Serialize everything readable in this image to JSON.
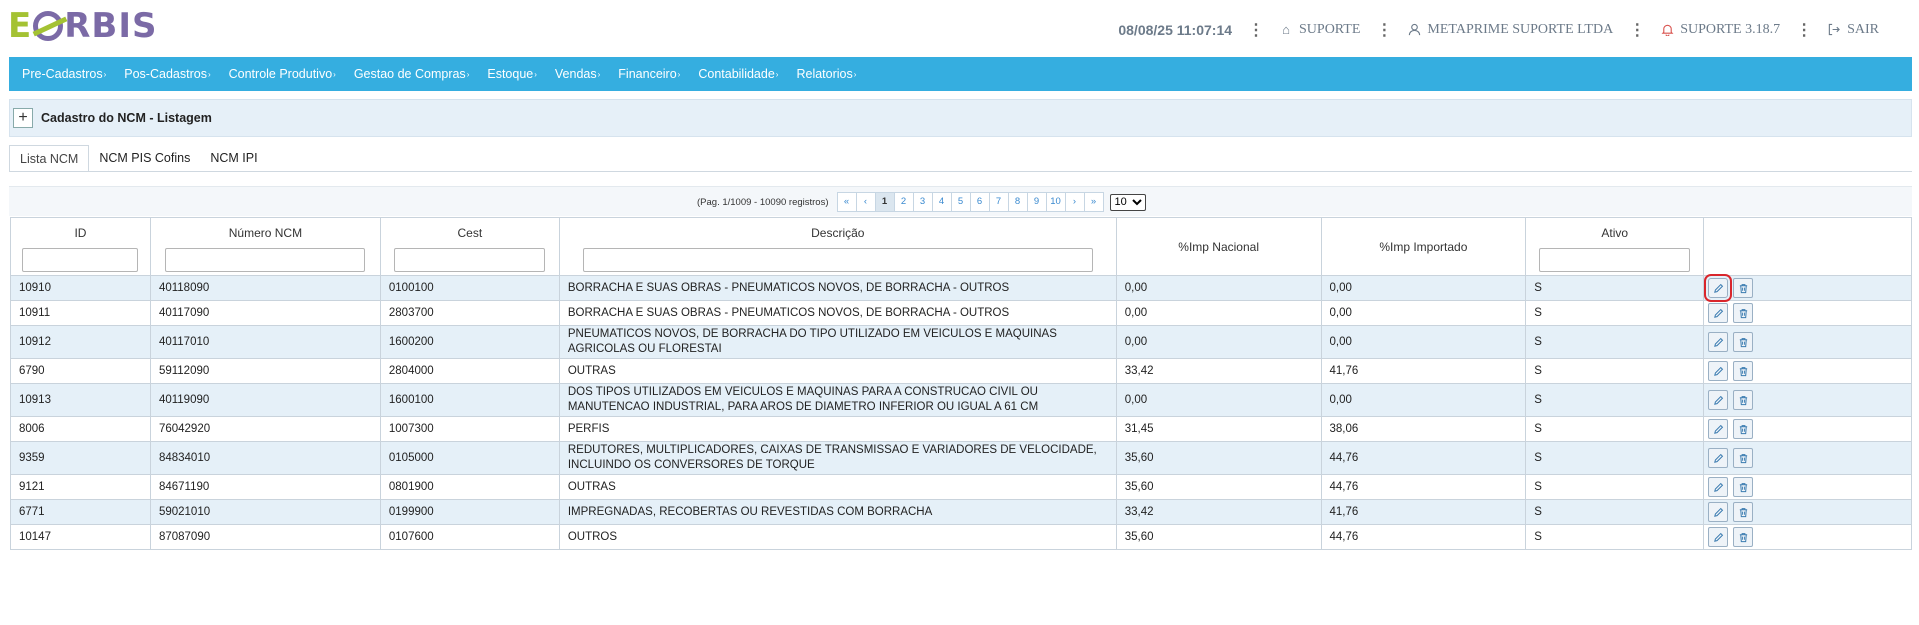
{
  "header": {
    "logo_e": "E",
    "logo_rest": "RBIS",
    "datetime": "08/08/25 11:07:14",
    "support_label": "SUPORTE",
    "company_label": "METAPRIME SUPORTE LTDA",
    "version_label": "SUPORTE 3.18.7",
    "exit_label": "SAIR"
  },
  "menu": [
    {
      "label": "Pre-Cadastros"
    },
    {
      "label": "Pos-Cadastros"
    },
    {
      "label": "Controle Produtivo"
    },
    {
      "label": "Gestao de Compras"
    },
    {
      "label": "Estoque"
    },
    {
      "label": "Vendas"
    },
    {
      "label": "Financeiro"
    },
    {
      "label": "Contabilidade"
    },
    {
      "label": "Relatorios"
    }
  ],
  "panel": {
    "add_label": "+",
    "title": "Cadastro do NCM - Listagem"
  },
  "tabs": [
    {
      "label": "Lista NCM",
      "active": true
    },
    {
      "label": "NCM PIS Cofins",
      "active": false
    },
    {
      "label": "NCM IPI",
      "active": false
    }
  ],
  "pager": {
    "info": "(Pag. 1/1009 - 10090 registros)",
    "first": "«",
    "prev": "‹",
    "pages": [
      "1",
      "2",
      "3",
      "4",
      "5",
      "6",
      "7",
      "8",
      "9",
      "10"
    ],
    "current_page": "1",
    "next": "›",
    "last": "»",
    "page_size": "10"
  },
  "table": {
    "columns": [
      "ID",
      "Número NCM",
      "Cest",
      "Descrição",
      "%Imp Nacional",
      "%Imp Importado",
      "Ativo",
      ""
    ],
    "rows": [
      {
        "id": "10910",
        "ncm": "40118090",
        "cest": "0100100",
        "desc": "BORRACHA E SUAS OBRAS - PNEUMATICOS NOVOS, DE BORRACHA - OUTROS",
        "nac": "0,00",
        "imp": "0,00",
        "ativo": "S"
      },
      {
        "id": "10911",
        "ncm": "40117090",
        "cest": "2803700",
        "desc": "BORRACHA E SUAS OBRAS - PNEUMATICOS NOVOS, DE BORRACHA - OUTROS",
        "nac": "0,00",
        "imp": "0,00",
        "ativo": "S"
      },
      {
        "id": "10912",
        "ncm": "40117010",
        "cest": "1600200",
        "desc": "PNEUMATICOS NOVOS, DE BORRACHA DO TIPO UTILIZADO EM VEICULOS E MAQUINAS AGRICOLAS OU FLORESTAI",
        "nac": "0,00",
        "imp": "0,00",
        "ativo": "S"
      },
      {
        "id": "6790",
        "ncm": "59112090",
        "cest": "2804000",
        "desc": "OUTRAS",
        "nac": "33,42",
        "imp": "41,76",
        "ativo": "S"
      },
      {
        "id": "10913",
        "ncm": "40119090",
        "cest": "1600100",
        "desc": "DOS TIPOS UTILIZADOS EM VEICULOS E MAQUINAS PARA A CONSTRUCAO CIVIL OU MANUTENCAO INDUSTRIAL, PARA AROS DE DIAMETRO INFERIOR OU IGUAL A 61 CM",
        "nac": "0,00",
        "imp": "0,00",
        "ativo": "S"
      },
      {
        "id": "8006",
        "ncm": "76042920",
        "cest": "1007300",
        "desc": "PERFIS",
        "nac": "31,45",
        "imp": "38,06",
        "ativo": "S"
      },
      {
        "id": "9359",
        "ncm": "84834010",
        "cest": "0105000",
        "desc": "REDUTORES, MULTIPLICADORES, CAIXAS DE TRANSMISSAO E VARIADORES DE VELOCIDADE, INCLUINDO OS CONVERSORES DE TORQUE",
        "nac": "35,60",
        "imp": "44,76",
        "ativo": "S"
      },
      {
        "id": "9121",
        "ncm": "84671190",
        "cest": "0801900",
        "desc": "OUTRAS",
        "nac": "35,60",
        "imp": "44,76",
        "ativo": "S"
      },
      {
        "id": "6771",
        "ncm": "59021010",
        "cest": "0199900",
        "desc": "IMPREGNADAS, RECOBERTAS OU REVESTIDAS COM BORRACHA",
        "nac": "33,42",
        "imp": "41,76",
        "ativo": "S"
      },
      {
        "id": "10147",
        "ncm": "87087090",
        "cest": "0107600",
        "desc": "OUTROS",
        "nac": "35,60",
        "imp": "44,76",
        "ativo": "S"
      }
    ]
  },
  "colors": {
    "menubar": "#35aee0",
    "row_alt": "#e5f0f8",
    "highlight": "#d9262c"
  },
  "icons": {
    "edit": "pencil-icon",
    "delete": "trash-icon"
  }
}
